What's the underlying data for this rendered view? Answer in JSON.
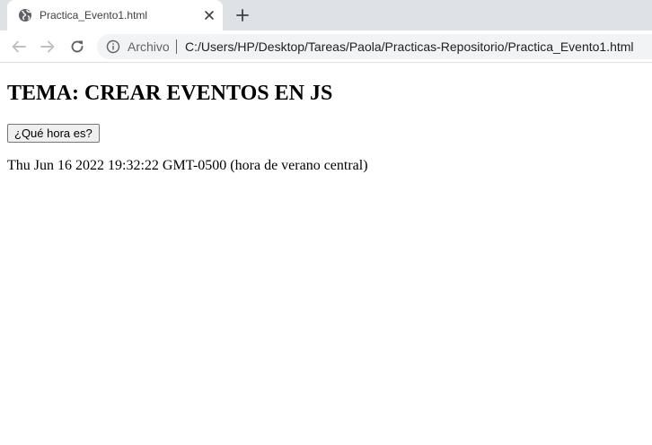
{
  "browser": {
    "tab": {
      "title": "Practica_Evento1.html",
      "favicon": "globe-icon"
    },
    "address_bar": {
      "scheme_label": "Archivo",
      "url": "C:/Users/HP/Desktop/Tareas/Paola/Practicas-Repositorio/Practica_Evento1.html"
    },
    "icons": {
      "back": "arrow-left-icon",
      "forward": "arrow-right-icon",
      "reload": "reload-icon",
      "info": "info-icon",
      "close": "close-icon",
      "new_tab": "plus-icon"
    }
  },
  "page": {
    "heading": "TEMA: CREAR EVENTOS EN JS",
    "button_label": "¿Qué hora es?",
    "output_text": "Thu Jun 16 2022 19:32:22 GMT-0500 (hora de verano central)"
  },
  "colors": {
    "tabstrip_bg": "#dee1e6",
    "omnibox_bg": "#f1f3f4",
    "icon_gray": "#5f6368",
    "disabled_gray": "#bdc1c6"
  }
}
